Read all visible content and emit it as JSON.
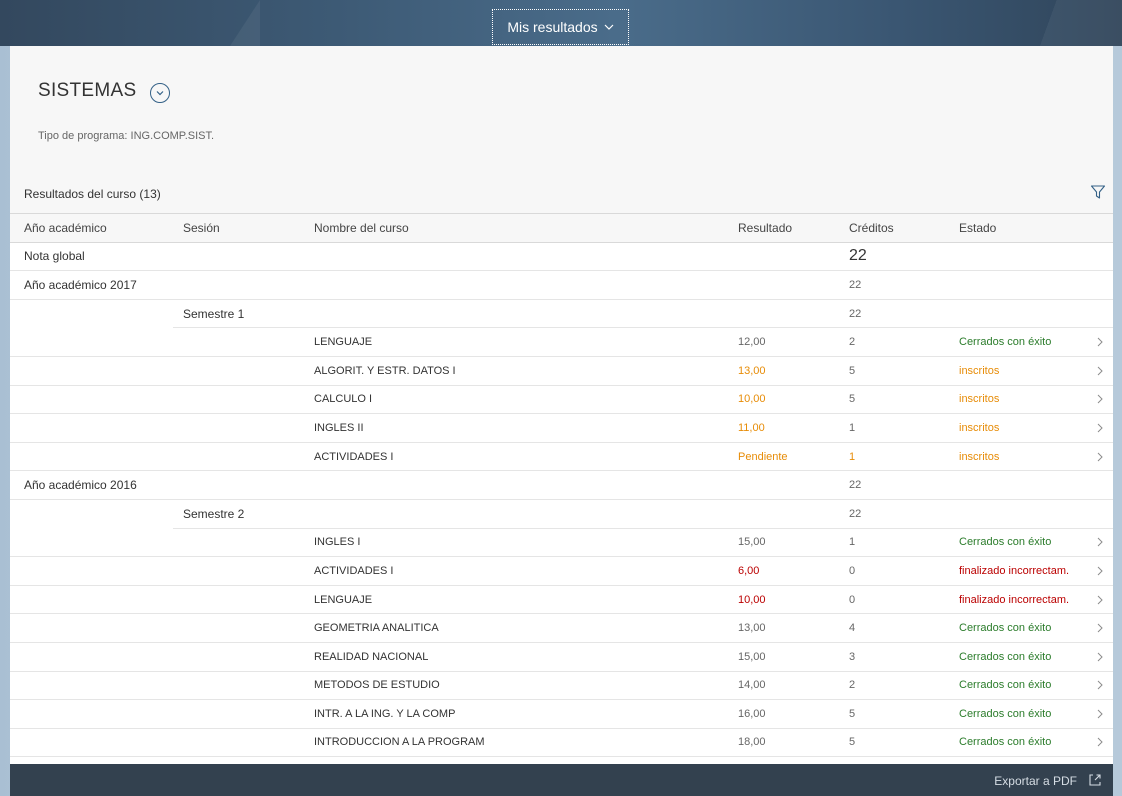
{
  "shell": {
    "title": "Mis resultados"
  },
  "program": {
    "name": "SISTEMAS",
    "type_label": "Tipo de programa: ING.COMP.SIST."
  },
  "table": {
    "title": "Resultados del curso (13)",
    "columns": {
      "year": "Año académico",
      "session": "Sesión",
      "course": "Nombre del curso",
      "result": "Resultado",
      "credits": "Créditos",
      "state": "Estado"
    },
    "overall": {
      "label": "Nota global",
      "credits": "22"
    },
    "groups": [
      {
        "year": "Año académico 2017",
        "credits": "22",
        "session": "Semestre 1",
        "session_credits": "22",
        "courses": [
          {
            "name": "LENGUAJE",
            "result": "12,00",
            "credits": "2",
            "state": "Cerrados con éxito",
            "result_color": "#666666",
            "credits_color": "#666666",
            "state_color": "#2b7c2b"
          },
          {
            "name": "ALGORIT. Y ESTR. DATOS I",
            "result": "13,00",
            "credits": "5",
            "state": "inscritos",
            "result_color": "#e78c07",
            "credits_color": "#666666",
            "state_color": "#e78c07"
          },
          {
            "name": "CALCULO I",
            "result": "10,00",
            "credits": "5",
            "state": "inscritos",
            "result_color": "#e78c07",
            "credits_color": "#666666",
            "state_color": "#e78c07"
          },
          {
            "name": "INGLES II",
            "result": "11,00",
            "credits": "1",
            "state": "inscritos",
            "result_color": "#e78c07",
            "credits_color": "#666666",
            "state_color": "#e78c07"
          },
          {
            "name": "ACTIVIDADES I",
            "result": "Pendiente",
            "credits": "1",
            "state": "inscritos",
            "result_color": "#e78c07",
            "credits_color": "#e78c07",
            "state_color": "#e78c07"
          }
        ]
      },
      {
        "year": "Año académico 2016",
        "credits": "22",
        "session": "Semestre 2",
        "session_credits": "22",
        "courses": [
          {
            "name": "INGLES I",
            "result": "15,00",
            "credits": "1",
            "state": "Cerrados con éxito",
            "result_color": "#666666",
            "credits_color": "#666666",
            "state_color": "#2b7c2b"
          },
          {
            "name": "ACTIVIDADES I",
            "result": "6,00",
            "credits": "0",
            "state": "finalizado incorrectam.",
            "result_color": "#bb0000",
            "credits_color": "#666666",
            "state_color": "#bb0000"
          },
          {
            "name": "LENGUAJE",
            "result": "10,00",
            "credits": "0",
            "state": "finalizado incorrectam.",
            "result_color": "#bb0000",
            "credits_color": "#666666",
            "state_color": "#bb0000"
          },
          {
            "name": "GEOMETRIA ANALITICA",
            "result": "13,00",
            "credits": "4",
            "state": "Cerrados con éxito",
            "result_color": "#666666",
            "credits_color": "#666666",
            "state_color": "#2b7c2b"
          },
          {
            "name": "REALIDAD NACIONAL",
            "result": "15,00",
            "credits": "3",
            "state": "Cerrados con éxito",
            "result_color": "#666666",
            "credits_color": "#666666",
            "state_color": "#2b7c2b"
          },
          {
            "name": "METODOS DE ESTUDIO",
            "result": "14,00",
            "credits": "2",
            "state": "Cerrados con éxito",
            "result_color": "#666666",
            "credits_color": "#666666",
            "state_color": "#2b7c2b"
          },
          {
            "name": "INTR. A LA ING. Y LA COMP",
            "result": "16,00",
            "credits": "5",
            "state": "Cerrados con éxito",
            "result_color": "#666666",
            "credits_color": "#666666",
            "state_color": "#2b7c2b"
          },
          {
            "name": "INTRODUCCION A LA PROGRAM",
            "result": "18,00",
            "credits": "5",
            "state": "Cerrados con éxito",
            "result_color": "#666666",
            "credits_color": "#666666",
            "state_color": "#2b7c2b"
          }
        ]
      }
    ]
  },
  "footer": {
    "export_label": "Exportar a PDF"
  },
  "icons": {
    "title_chevron": "chevron-down-icon",
    "program_toggle": "chevron-down-circle-icon",
    "filter": "filter-icon",
    "row_nav": "chevron-right-icon",
    "export": "share-icon"
  },
  "colors": {
    "success": "#2b7c2b",
    "warning": "#e78c07",
    "error": "#bb0000",
    "accent": "#346187",
    "footer_bg": "#33414f"
  }
}
